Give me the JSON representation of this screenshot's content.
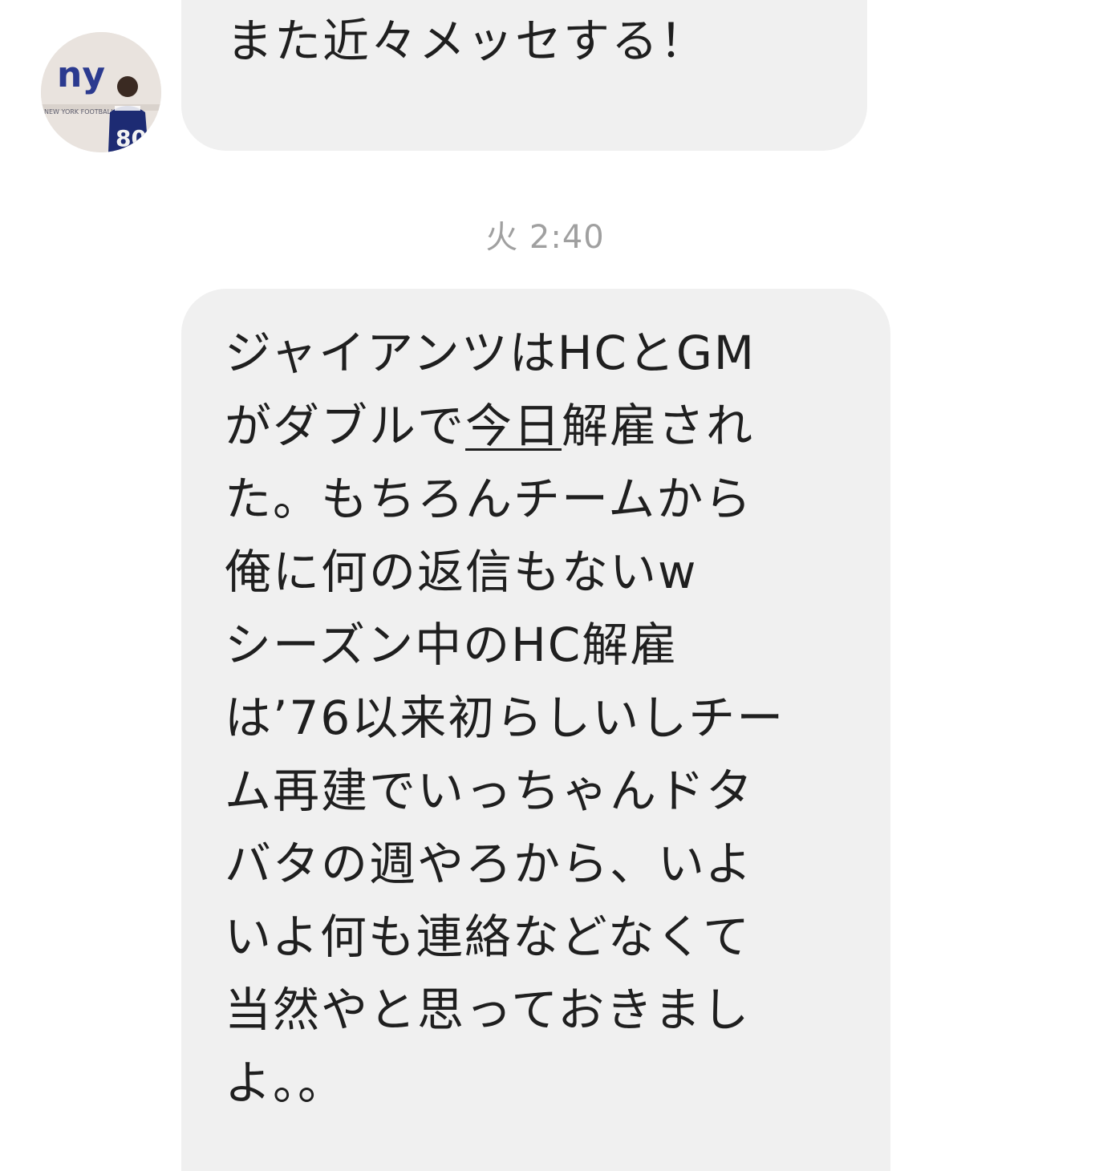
{
  "conversation": {
    "avatar": {
      "icon": "profile-photo-icon",
      "logo_text": "ny",
      "caption_text": "NEW YORK FOOTBALL",
      "jersey_text": "80",
      "logo_color": "#2b3a8f",
      "logo_accent": "#b8202e"
    },
    "messages": [
      {
        "text": "また近々メッセする！"
      },
      {
        "timestamp": "火 2:40"
      },
      {
        "lines": [
          {
            "parts": [
              "ジャイアンツはHCとGM"
            ]
          },
          {
            "parts": [
              "がダブルで",
              "今日",
              "解雇され"
            ],
            "underline_index": 1
          },
          {
            "parts": [
              "た。もちろんチームから"
            ]
          },
          {
            "parts": [
              "俺に何の返信もないw"
            ]
          },
          {
            "parts": [
              "シーズン中のHC解雇"
            ]
          },
          {
            "parts": [
              "は’76以来初らしいしチー"
            ]
          },
          {
            "parts": [
              "ム再建でいっちゃんドタ"
            ]
          },
          {
            "parts": [
              "バタの週やろから、いよ"
            ]
          },
          {
            "parts": [
              "いよ何も連絡などなくて"
            ]
          },
          {
            "parts": [
              "当然やと思っておきまし"
            ]
          },
          {
            "parts": [
              "よ。。"
            ]
          }
        ]
      }
    ],
    "colors": {
      "bubble": "#f0f0f0",
      "text": "#1f1f1f",
      "timestamp": "#a0a0a0"
    }
  }
}
